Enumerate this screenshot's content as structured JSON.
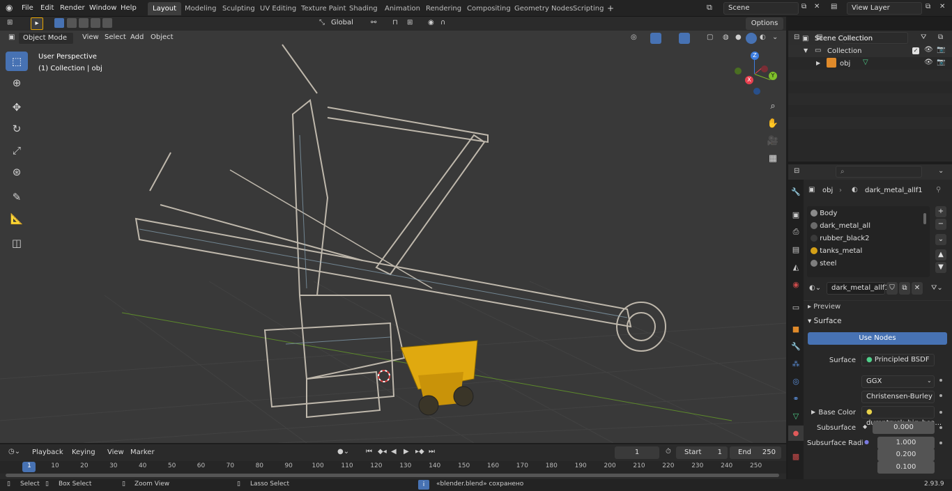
{
  "menus": [
    "File",
    "Edit",
    "Render",
    "Window",
    "Help"
  ],
  "workspaces": [
    "Layout",
    "Modeling",
    "Sculpting",
    "UV Editing",
    "Texture Paint",
    "Shading",
    "Animation",
    "Rendering",
    "Compositing",
    "Geometry Nodes",
    "Scripting"
  ],
  "scene": {
    "name": "Scene",
    "view_layer": "View Layer"
  },
  "viewport_header": {
    "mode": "Object Mode",
    "view": "View",
    "select": "Select",
    "add": "Add",
    "object": "Object",
    "orientation": "Global",
    "options": "Options"
  },
  "viewport": {
    "perspective": "User Perspective",
    "collection": "(1) Collection | obj"
  },
  "gizmo": {
    "x": "X",
    "y": "Y",
    "z": "Z"
  },
  "outliner": {
    "scene_collection": "Scene Collection",
    "collection": "Collection",
    "obj": "obj"
  },
  "properties": {
    "object_name": "obj",
    "material_name": "dark_metal_allf1",
    "materials": [
      {
        "name": "Body",
        "color": "#8a8a8a"
      },
      {
        "name": "dark_metal_all",
        "color": "#6a6a6a"
      },
      {
        "name": "rubber_black2",
        "color": "#3a3a3a"
      },
      {
        "name": "tanks_metal",
        "color": "#d4a017"
      },
      {
        "name": "steel",
        "color": "#7e7e7e"
      }
    ],
    "slot_material": "dark_metal_allf1",
    "preview": "Preview",
    "surface_section": "Surface",
    "use_nodes": "Use Nodes",
    "surface_label": "Surface",
    "surface_value": "Principled BSDF",
    "distribution": "GGX",
    "subsurface_method": "Christensen-Burley",
    "base_color_label": "Base Color",
    "base_color_value": "dumptruck_big_hea...",
    "subsurface_label": "Subsurface",
    "subsurface_value": "0.000",
    "subsurface_radius_label": "Subsurface Radi...",
    "radius": [
      "1.000",
      "0.200",
      "0.100"
    ]
  },
  "timeline": {
    "playback": "Playback",
    "keying": "Keying",
    "view": "View",
    "marker": "Marker",
    "current_frame": "1",
    "start_label": "Start",
    "start": "1",
    "end_label": "End",
    "end": "250",
    "ruler": [
      "1",
      "10",
      "20",
      "30",
      "40",
      "50",
      "60",
      "70",
      "80",
      "90",
      "100",
      "110",
      "120",
      "130",
      "140",
      "150",
      "160",
      "170",
      "180",
      "190",
      "200",
      "210",
      "220",
      "230",
      "240",
      "250"
    ]
  },
  "status": {
    "select": "Select",
    "box_select": "Box Select",
    "zoom_view": "Zoom View",
    "lasso_select": "Lasso Select",
    "message": "«blender.blend» сохранено",
    "version": "2.93.9"
  },
  "colors": {
    "accent": "#4772b3",
    "x_axis": "#e8404f",
    "y_axis": "#7fbf2a",
    "z_axis": "#3d7ee0",
    "truck": "#e0a90f"
  }
}
